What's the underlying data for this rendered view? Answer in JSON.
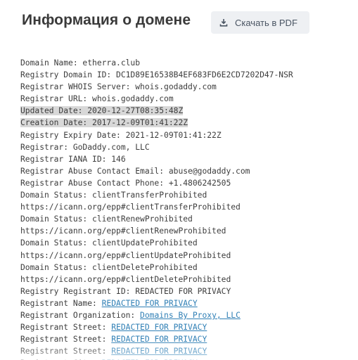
{
  "header": {
    "title": "Информация о домене",
    "pdf_button_label": "Скачать в PDF",
    "pdf_icon": "download-icon"
  },
  "colors": {
    "link": "#2f7fb5",
    "highlight": "#d8d8d8",
    "button_bg": "#eef0f3",
    "title": "#3a3a3a"
  },
  "whois": {
    "rows": [
      {
        "label": "Domain Name: etherra.club",
        "link": null,
        "highlight": false
      },
      {
        "label": "Registry Domain ID: DC1D89E16538B4EF683FD6E2CD7202D47-NSR",
        "link": null,
        "highlight": false
      },
      {
        "label": "Registrar WHOIS Server: whois.godaddy.com",
        "link": null,
        "highlight": false
      },
      {
        "label": "Registrar URL: whois.godaddy.com",
        "link": null,
        "highlight": false
      },
      {
        "label": "Updated Date: 2020-12-27T08:35:48Z",
        "link": null,
        "highlight": true
      },
      {
        "label": "Creation Date: 2017-12-09T01:41:22Z",
        "link": null,
        "highlight": true
      },
      {
        "label": "Registry Expiry Date: 2021-12-09T01:41:22Z",
        "link": null,
        "highlight": false
      },
      {
        "label": "Registrar: GoDaddy.com, LLC",
        "link": null,
        "highlight": false
      },
      {
        "label": "Registrar IANA ID: 146",
        "link": null,
        "highlight": false
      },
      {
        "label": "Registrar Abuse Contact Email: abuse@godaddy.com",
        "link": null,
        "highlight": false
      },
      {
        "label": "Registrar Abuse Contact Phone: +1.4806242505",
        "link": null,
        "highlight": false
      },
      {
        "label": "Domain Status: clientTransferProhibited",
        "link": null,
        "highlight": false
      },
      {
        "label": "https://icann.org/epp#clientTransferProhibited",
        "link": null,
        "highlight": false
      },
      {
        "label": "Domain Status: clientRenewProhibited",
        "link": null,
        "highlight": false
      },
      {
        "label": "https://icann.org/epp#clientRenewProhibited",
        "link": null,
        "highlight": false
      },
      {
        "label": "Domain Status: clientUpdateProhibited",
        "link": null,
        "highlight": false
      },
      {
        "label": "https://icann.org/epp#clientUpdateProhibited",
        "link": null,
        "highlight": false
      },
      {
        "label": "Domain Status: clientDeleteProhibited",
        "link": null,
        "highlight": false
      },
      {
        "label": "https://icann.org/epp#clientDeleteProhibited",
        "link": null,
        "highlight": false
      },
      {
        "label": "Registry Registrant ID: REDACTED FOR PRIVACY",
        "link": null,
        "highlight": false
      },
      {
        "label": "Registrant Name: ",
        "link": "REDACTED FOR PRIVACY",
        "highlight": false
      },
      {
        "label": "Registrant Organization: ",
        "link": "Domains By Proxy, LLC",
        "highlight": false
      },
      {
        "label": "Registrant Street: ",
        "link": "REDACTED FOR PRIVACY",
        "highlight": false
      },
      {
        "label": "Registrant Street: ",
        "link": "REDACTED FOR PRIVACY",
        "highlight": false
      },
      {
        "label": "Registrant Street: ",
        "link": "REDACTED FOR PRIVACY",
        "highlight": false
      },
      {
        "label": "Registrant City: ",
        "link": "REDACTED FOR PRIVACY",
        "highlight": false
      }
    ]
  }
}
